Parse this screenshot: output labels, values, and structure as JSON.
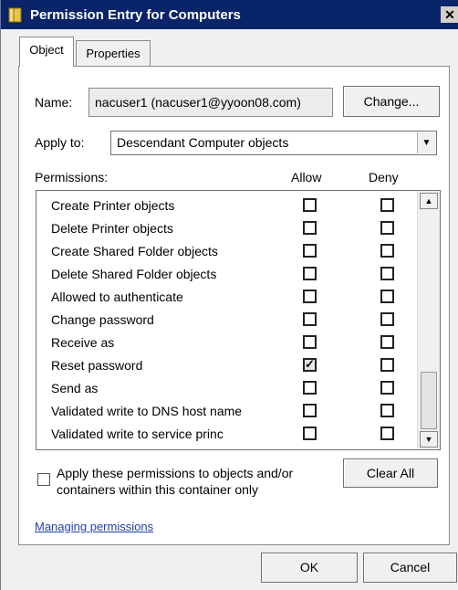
{
  "window": {
    "title": "Permission Entry for Computers",
    "close_glyph": "✕"
  },
  "tabs": [
    {
      "label": "Object"
    },
    {
      "label": "Properties"
    }
  ],
  "name": {
    "label": "Name:",
    "value": "nacuser1 (nacuser1@yyoon08.com)",
    "change_button": "Change..."
  },
  "apply_to": {
    "label": "Apply to:",
    "value": "Descendant Computer objects"
  },
  "permissions": {
    "label": "Permissions:",
    "allow_header": "Allow",
    "deny_header": "Deny",
    "rows": [
      {
        "label": "Create Printer objects",
        "allow": false,
        "deny": false
      },
      {
        "label": "Delete Printer objects",
        "allow": false,
        "deny": false
      },
      {
        "label": "Create Shared Folder objects",
        "allow": false,
        "deny": false
      },
      {
        "label": "Delete Shared Folder objects",
        "allow": false,
        "deny": false
      },
      {
        "label": "Allowed to authenticate",
        "allow": false,
        "deny": false
      },
      {
        "label": "Change password",
        "allow": false,
        "deny": false
      },
      {
        "label": "Receive as",
        "allow": false,
        "deny": false
      },
      {
        "label": "Reset password",
        "allow": true,
        "deny": false
      },
      {
        "label": "Send as",
        "allow": false,
        "deny": false
      },
      {
        "label": "Validated write to DNS host name",
        "allow": false,
        "deny": false
      },
      {
        "label": "Validated write to service princ",
        "allow": false,
        "deny": false
      }
    ]
  },
  "apply_container": {
    "text_line1": "Apply these permissions to objects and/or",
    "text_line2": "containers within this container only",
    "checked": false
  },
  "clear_all_button": "Clear All",
  "managing_link": "Managing permissions",
  "ok_button": "OK",
  "cancel_button": "Cancel",
  "colors": {
    "titlebar": "#0a246a",
    "link": "#1f3fae"
  }
}
